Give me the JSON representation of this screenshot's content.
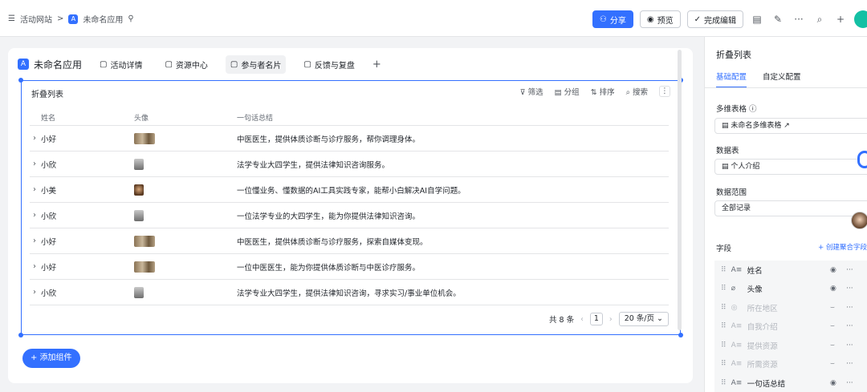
{
  "topbar": {
    "breadcrumb_icon": "tree-list-icon",
    "site": "活动网站",
    "sep": ">",
    "app_badge": "A",
    "app": "未命名应用",
    "share": "分享",
    "preview": "预览",
    "finish": "完成编辑"
  },
  "tabs": {
    "app_badge": "A",
    "app_name": "未命名应用",
    "items": [
      "活动详情",
      "资源中心",
      "参与者名片",
      "反馈与复盘"
    ],
    "add": "+"
  },
  "widget": {
    "title": "折叠列表",
    "tools": {
      "filter": "筛选",
      "group": "分组",
      "sort": "排序",
      "search": "搜索"
    },
    "columns": [
      "姓名",
      "头像",
      "一句话总结"
    ],
    "rows": [
      {
        "name": "小好",
        "avatar": "wide",
        "summary": "中医医生，提供体质诊断与诊疗服务，帮你调理身体。"
      },
      {
        "name": "小欣",
        "avatar": "small",
        "summary": "法学专业大四学生，提供法律知识咨询服务。"
      },
      {
        "name": "小美",
        "avatar": "face",
        "summary": "一位懂业务、懂数据的AI工具实践专家，能帮小白解决AI自学问题。"
      },
      {
        "name": "小欣",
        "avatar": "small",
        "summary": "一位法学专业的大四学生，能为你提供法律知识咨询。"
      },
      {
        "name": "小好",
        "avatar": "wide",
        "summary": "中医医生，提供体质诊断与诊疗服务，探索自媒体变现。"
      },
      {
        "name": "小好",
        "avatar": "wide",
        "summary": "一位中医医生，能为你提供体质诊断与中医诊疗服务。"
      },
      {
        "name": "小欣",
        "avatar": "small",
        "summary": "法学专业大四学生，提供法律知识咨询，寻求实习/事业单位机会。"
      }
    ],
    "pager": {
      "total": "共 8 条",
      "page": "1",
      "size": "20 条/页"
    }
  },
  "add_widget": "+ 添加组件",
  "panel": {
    "title": "折叠列表",
    "tabs": [
      "基础配置",
      "自定义配置"
    ],
    "table_label": "多维表格 ⓘ",
    "table_value": "未命名多维表格",
    "sheet_label": "数据表",
    "sheet_value": "个人介绍",
    "range_label": "数据范围",
    "range_value": "全部记录",
    "fields_label": "字段",
    "fields_add": "+ 创建聚合字段",
    "fields": [
      {
        "type": "A≡",
        "name": "姓名",
        "visible": true
      },
      {
        "type": "⌀",
        "name": "头像",
        "visible": true
      },
      {
        "type": "◎",
        "name": "所在地区",
        "visible": false
      },
      {
        "type": "A≡",
        "name": "自我介绍",
        "visible": false
      },
      {
        "type": "A≡",
        "name": "提供资源",
        "visible": false
      },
      {
        "type": "A≡",
        "name": "所需资源",
        "visible": false
      },
      {
        "type": "A≡",
        "name": "一句话总结",
        "visible": true
      }
    ]
  }
}
